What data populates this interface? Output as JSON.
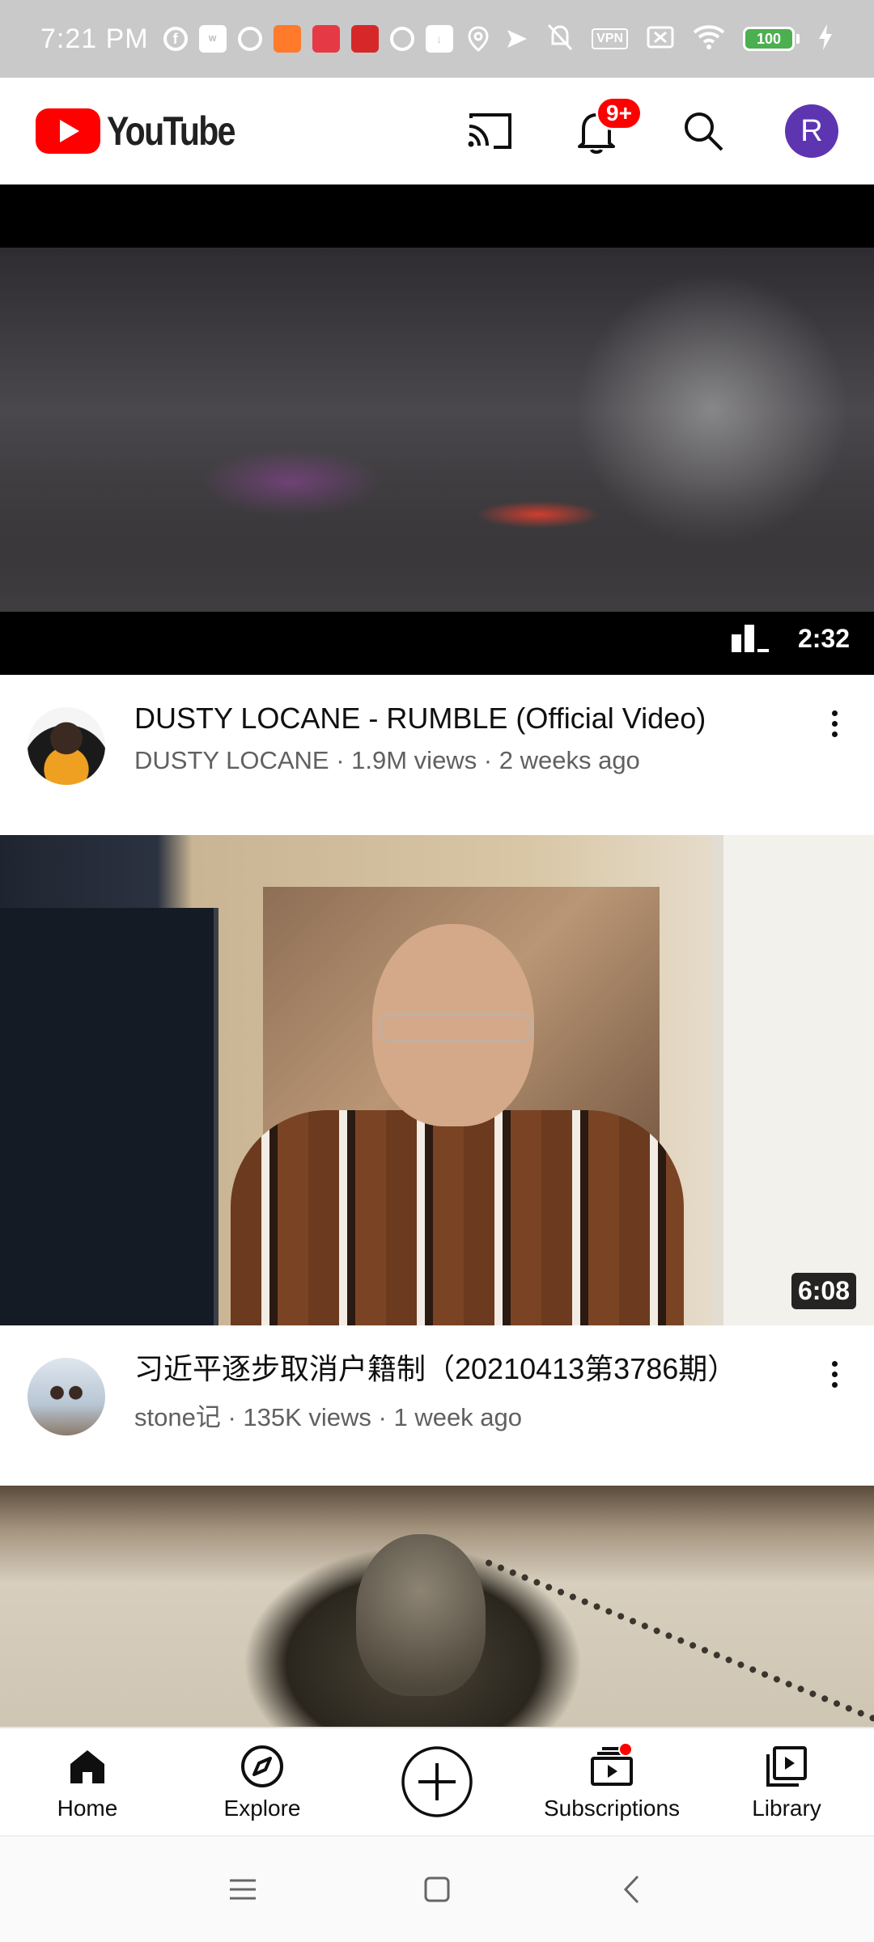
{
  "status_bar": {
    "time": "7:21 PM",
    "vpn": "VPN",
    "battery": "100"
  },
  "header": {
    "logo_text": "YouTube",
    "notification_count": "9+",
    "avatar_letter": "R",
    "avatar_color": "#5e35b1"
  },
  "feed": {
    "videos": [
      {
        "title": "DUSTY LOCANE - RUMBLE (Official Video)",
        "subtitle": "DUSTY LOCANE · 1.9M views · 2 weeks ago",
        "duration": "2:32"
      },
      {
        "title": "习近平逐步取消户籍制（20210413第3786期）",
        "subtitle": "stone记 · 135K views · 1 week ago",
        "duration": "6:08"
      }
    ]
  },
  "bottom_nav": {
    "items": [
      {
        "label": "Home",
        "icon": "home-icon"
      },
      {
        "label": "Explore",
        "icon": "compass-icon"
      },
      {
        "label": "",
        "icon": "add-circle-icon"
      },
      {
        "label": "Subscriptions",
        "icon": "subscriptions-icon"
      },
      {
        "label": "Library",
        "icon": "library-icon"
      }
    ]
  },
  "colors": {
    "brand_red": "#ff0000",
    "text_primary": "#0f0f0f",
    "text_secondary": "#606060"
  }
}
